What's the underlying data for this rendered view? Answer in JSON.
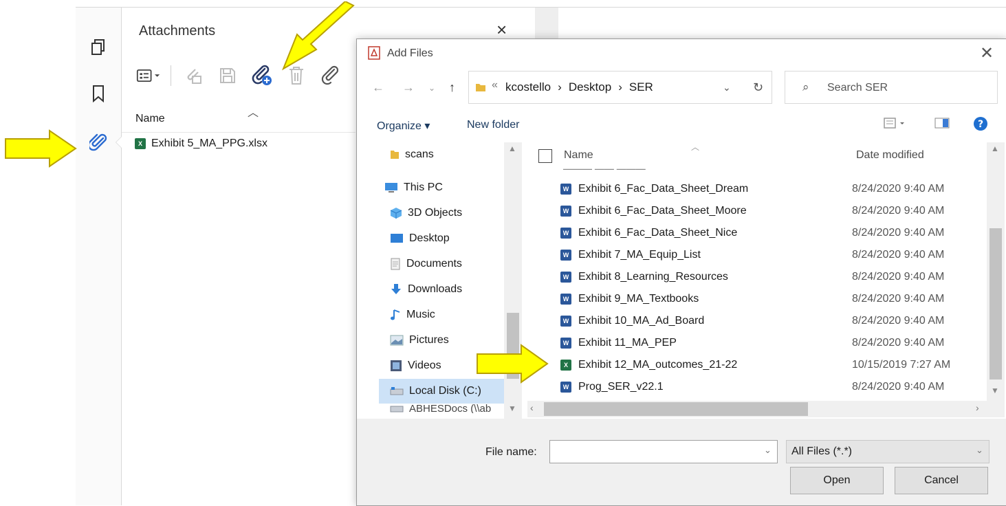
{
  "attachments_panel": {
    "title": "Attachments",
    "close_label": "×",
    "column_name": "Name",
    "attachment": "Exhibit 5_MA_PPG.xlsx"
  },
  "dialog": {
    "title": "Add Files",
    "close_label": "✕",
    "breadcrumb": [
      "kcostello",
      "Desktop",
      "SER"
    ],
    "breadcrumb_overflow": "«",
    "search_placeholder": "Search SER",
    "organize_label": "Organize ▾",
    "new_folder_label": "New folder",
    "nav_items": [
      {
        "label": "scans",
        "icon": "folder-icon"
      },
      {
        "label": "This PC",
        "icon": "computer-icon"
      },
      {
        "label": "3D Objects",
        "icon": "cube-icon"
      },
      {
        "label": "Desktop",
        "icon": "desktop-icon"
      },
      {
        "label": "Documents",
        "icon": "documents-icon"
      },
      {
        "label": "Downloads",
        "icon": "download-icon"
      },
      {
        "label": "Music",
        "icon": "music-icon"
      },
      {
        "label": "Pictures",
        "icon": "pictures-icon"
      },
      {
        "label": "Videos",
        "icon": "videos-icon"
      },
      {
        "label": "Local Disk (C:)",
        "icon": "disk-icon"
      },
      {
        "label": "ABHESDocs (\\\\ab",
        "icon": "network-drive-icon"
      }
    ],
    "columns": {
      "name": "Name",
      "date": "Date modified"
    },
    "files": [
      {
        "name": "Exhibit 6_Fac_Data_Sheet_Dream",
        "date": "8/24/2020 9:40 AM",
        "type": "word"
      },
      {
        "name": "Exhibit 6_Fac_Data_Sheet_Moore",
        "date": "8/24/2020 9:40 AM",
        "type": "word"
      },
      {
        "name": "Exhibit 6_Fac_Data_Sheet_Nice",
        "date": "8/24/2020 9:40 AM",
        "type": "word"
      },
      {
        "name": "Exhibit 7_MA_Equip_List",
        "date": "8/24/2020 9:40 AM",
        "type": "word"
      },
      {
        "name": "Exhibit 8_Learning_Resources",
        "date": "8/24/2020 9:40 AM",
        "type": "word"
      },
      {
        "name": "Exhibit 9_MA_Textbooks",
        "date": "8/24/2020 9:40 AM",
        "type": "word"
      },
      {
        "name": "Exhibit 10_MA_Ad_Board",
        "date": "8/24/2020 9:40 AM",
        "type": "word"
      },
      {
        "name": "Exhibit 11_MA_PEP",
        "date": "8/24/2020 9:40 AM",
        "type": "word"
      },
      {
        "name": "Exhibit 12_MA_outcomes_21-22",
        "date": "10/15/2019 7:27 AM",
        "type": "excel"
      },
      {
        "name": "Prog_SER_v22.1",
        "date": "8/24/2020 9:40 AM",
        "type": "word"
      }
    ],
    "file_name_label": "File name:",
    "file_name_value": "",
    "filter_label": "All Files (*.*)",
    "open_label": "Open",
    "cancel_label": "Cancel"
  },
  "colors": {
    "arrow": "#ffff00",
    "arrow_outline": "#b8a000",
    "selection": "#cde2f7"
  }
}
